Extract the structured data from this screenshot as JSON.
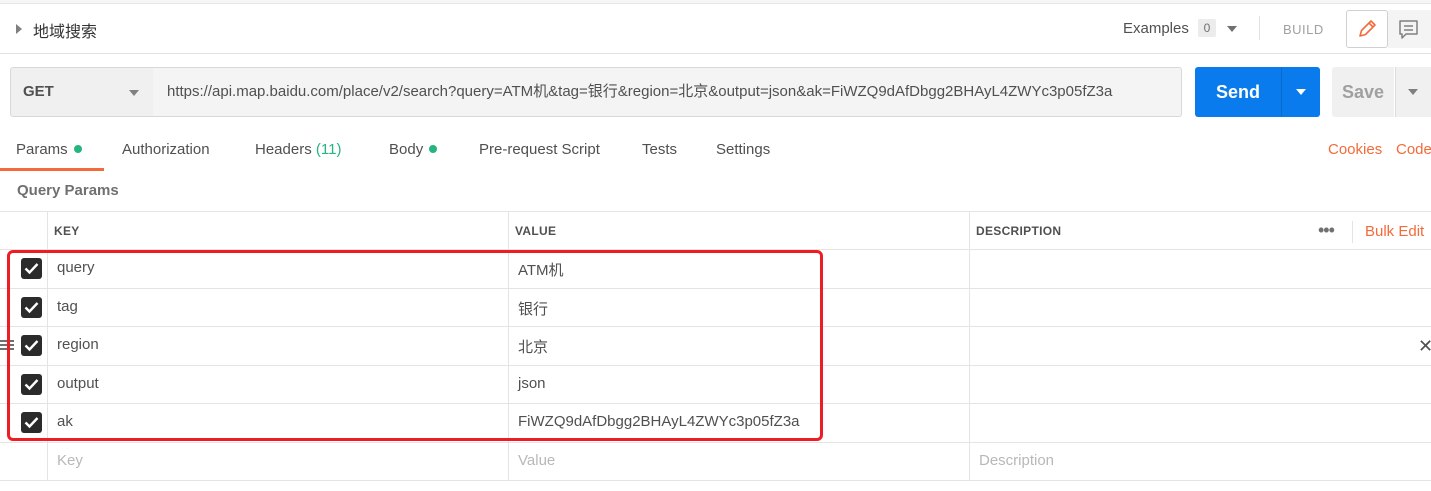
{
  "request": {
    "name": "地域搜索",
    "method": "GET",
    "url": "https://api.map.baidu.com/place/v2/search?query=ATM机&tag=银行&region=北京&output=json&ak=FiWZQ9dAfDbgg2BHAyL4ZWYc3p05fZ3a"
  },
  "header": {
    "examples_label": "Examples",
    "examples_count": "0",
    "build_label": "BUILD"
  },
  "buttons": {
    "send": "Send",
    "save": "Save"
  },
  "tabs": [
    {
      "label": "Params",
      "has_dot": true
    },
    {
      "label": "Authorization"
    },
    {
      "label": "Headers",
      "count": "(11)"
    },
    {
      "label": "Body",
      "has_dot": true
    },
    {
      "label": "Pre-request Script"
    },
    {
      "label": "Tests"
    },
    {
      "label": "Settings"
    }
  ],
  "links": {
    "cookies": "Cookies",
    "code": "Code"
  },
  "query_params": {
    "title": "Query Params",
    "headers": {
      "key": "KEY",
      "value": "VALUE",
      "description": "DESCRIPTION"
    },
    "bulk_edit": "Bulk Edit",
    "rows": [
      {
        "key": "query",
        "value": "ATM机",
        "checked": true
      },
      {
        "key": "tag",
        "value": "银行",
        "checked": true
      },
      {
        "key": "region",
        "value": "北京",
        "checked": true
      },
      {
        "key": "output",
        "value": "json",
        "checked": true
      },
      {
        "key": "ak",
        "value": "FiWZQ9dAfDbgg2BHAyL4ZWYc3p05fZ3a",
        "checked": true
      }
    ],
    "placeholders": {
      "key": "Key",
      "value": "Value",
      "description": "Description"
    }
  },
  "colors": {
    "accent": "#f26b3a",
    "send_blue": "#097bed",
    "status_green": "#26b47f",
    "highlight_red": "#ee1c25"
  }
}
